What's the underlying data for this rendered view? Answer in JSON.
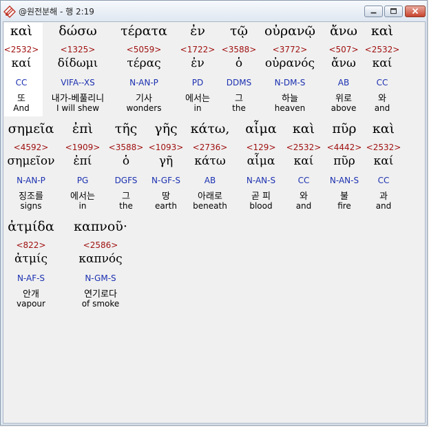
{
  "window": {
    "title": "@원전분해 - 행 2:19"
  },
  "controls": {
    "minimize_icon": "minimize-icon",
    "maximize_icon": "maximize-icon",
    "close_icon": "close-icon"
  },
  "words": [
    {
      "greek": "καὶ",
      "num": "<2532>",
      "lemma": "καί",
      "parse": "CC",
      "kor": "또",
      "eng": "And"
    },
    {
      "greek": "δώσω",
      "num": "<1325>",
      "lemma": "δίδωμι",
      "parse": "VIFA--XS",
      "kor": "내가-베풀리니",
      "eng": "I will shew"
    },
    {
      "greek": "τέρατα",
      "num": "<5059>",
      "lemma": "τέρας",
      "parse": "N-AN-P",
      "kor": "기사",
      "eng": "wonders"
    },
    {
      "greek": "ἐν",
      "num": "<1722>",
      "lemma": "ἐν",
      "parse": "PD",
      "kor": "에서는",
      "eng": "in"
    },
    {
      "greek": "τῷ",
      "num": "<3588>",
      "lemma": "ὁ",
      "parse": "DDMS",
      "kor": "그",
      "eng": "the"
    },
    {
      "greek": "οὐρανῷ",
      "num": "<3772>",
      "lemma": "οὐρανός",
      "parse": "N-DM-S",
      "kor": "하늘",
      "eng": "heaven"
    },
    {
      "greek": "ἄνω",
      "num": "<507>",
      "lemma": "ἄνω",
      "parse": "AB",
      "kor": "위로",
      "eng": "above"
    },
    {
      "greek": "καὶ",
      "num": "<2532>",
      "lemma": "καί",
      "parse": "CC",
      "kor": "와",
      "eng": "and"
    },
    {
      "greek": "σημεῖα",
      "num": "<4592>",
      "lemma": "σημεῖον",
      "parse": "N-AN-P",
      "kor": "징조를",
      "eng": "signs"
    },
    {
      "greek": "ἐπὶ",
      "num": "<1909>",
      "lemma": "ἐπί",
      "parse": "PG",
      "kor": "에서는",
      "eng": "in"
    },
    {
      "greek": "τῆς",
      "num": "<3588>",
      "lemma": "ὁ",
      "parse": "DGFS",
      "kor": "그",
      "eng": "the"
    },
    {
      "greek": "γῆς",
      "num": "<1093>",
      "lemma": "γῆ",
      "parse": "N-GF-S",
      "kor": "땅",
      "eng": "earth"
    },
    {
      "greek": "κάτω,",
      "num": "<2736>",
      "lemma": "κάτω",
      "parse": "AB",
      "kor": "아래로",
      "eng": "beneath"
    },
    {
      "greek": "αἷμα",
      "num": "<129>",
      "lemma": "αἷμα",
      "parse": "N-AN-S",
      "kor": "곧 피",
      "eng": "blood"
    },
    {
      "greek": "καὶ",
      "num": "<2532>",
      "lemma": "καί",
      "parse": "CC",
      "kor": "와",
      "eng": "and"
    },
    {
      "greek": "πῦρ",
      "num": "<4442>",
      "lemma": "πῦρ",
      "parse": "N-AN-S",
      "kor": "불",
      "eng": "fire"
    },
    {
      "greek": "καὶ",
      "num": "<2532>",
      "lemma": "καί",
      "parse": "CC",
      "kor": "과",
      "eng": "and"
    },
    {
      "greek": "ἀτμίδα",
      "num": "<822>",
      "lemma": "ἀτμίς",
      "parse": "N-AF-S",
      "kor": "안개",
      "eng": "vapour"
    },
    {
      "greek": "καπνοῦ·",
      "num": "<2586>",
      "lemma": "καπνός",
      "parse": "N-GM-S",
      "kor": "연기로다",
      "eng": "of smoke"
    }
  ]
}
